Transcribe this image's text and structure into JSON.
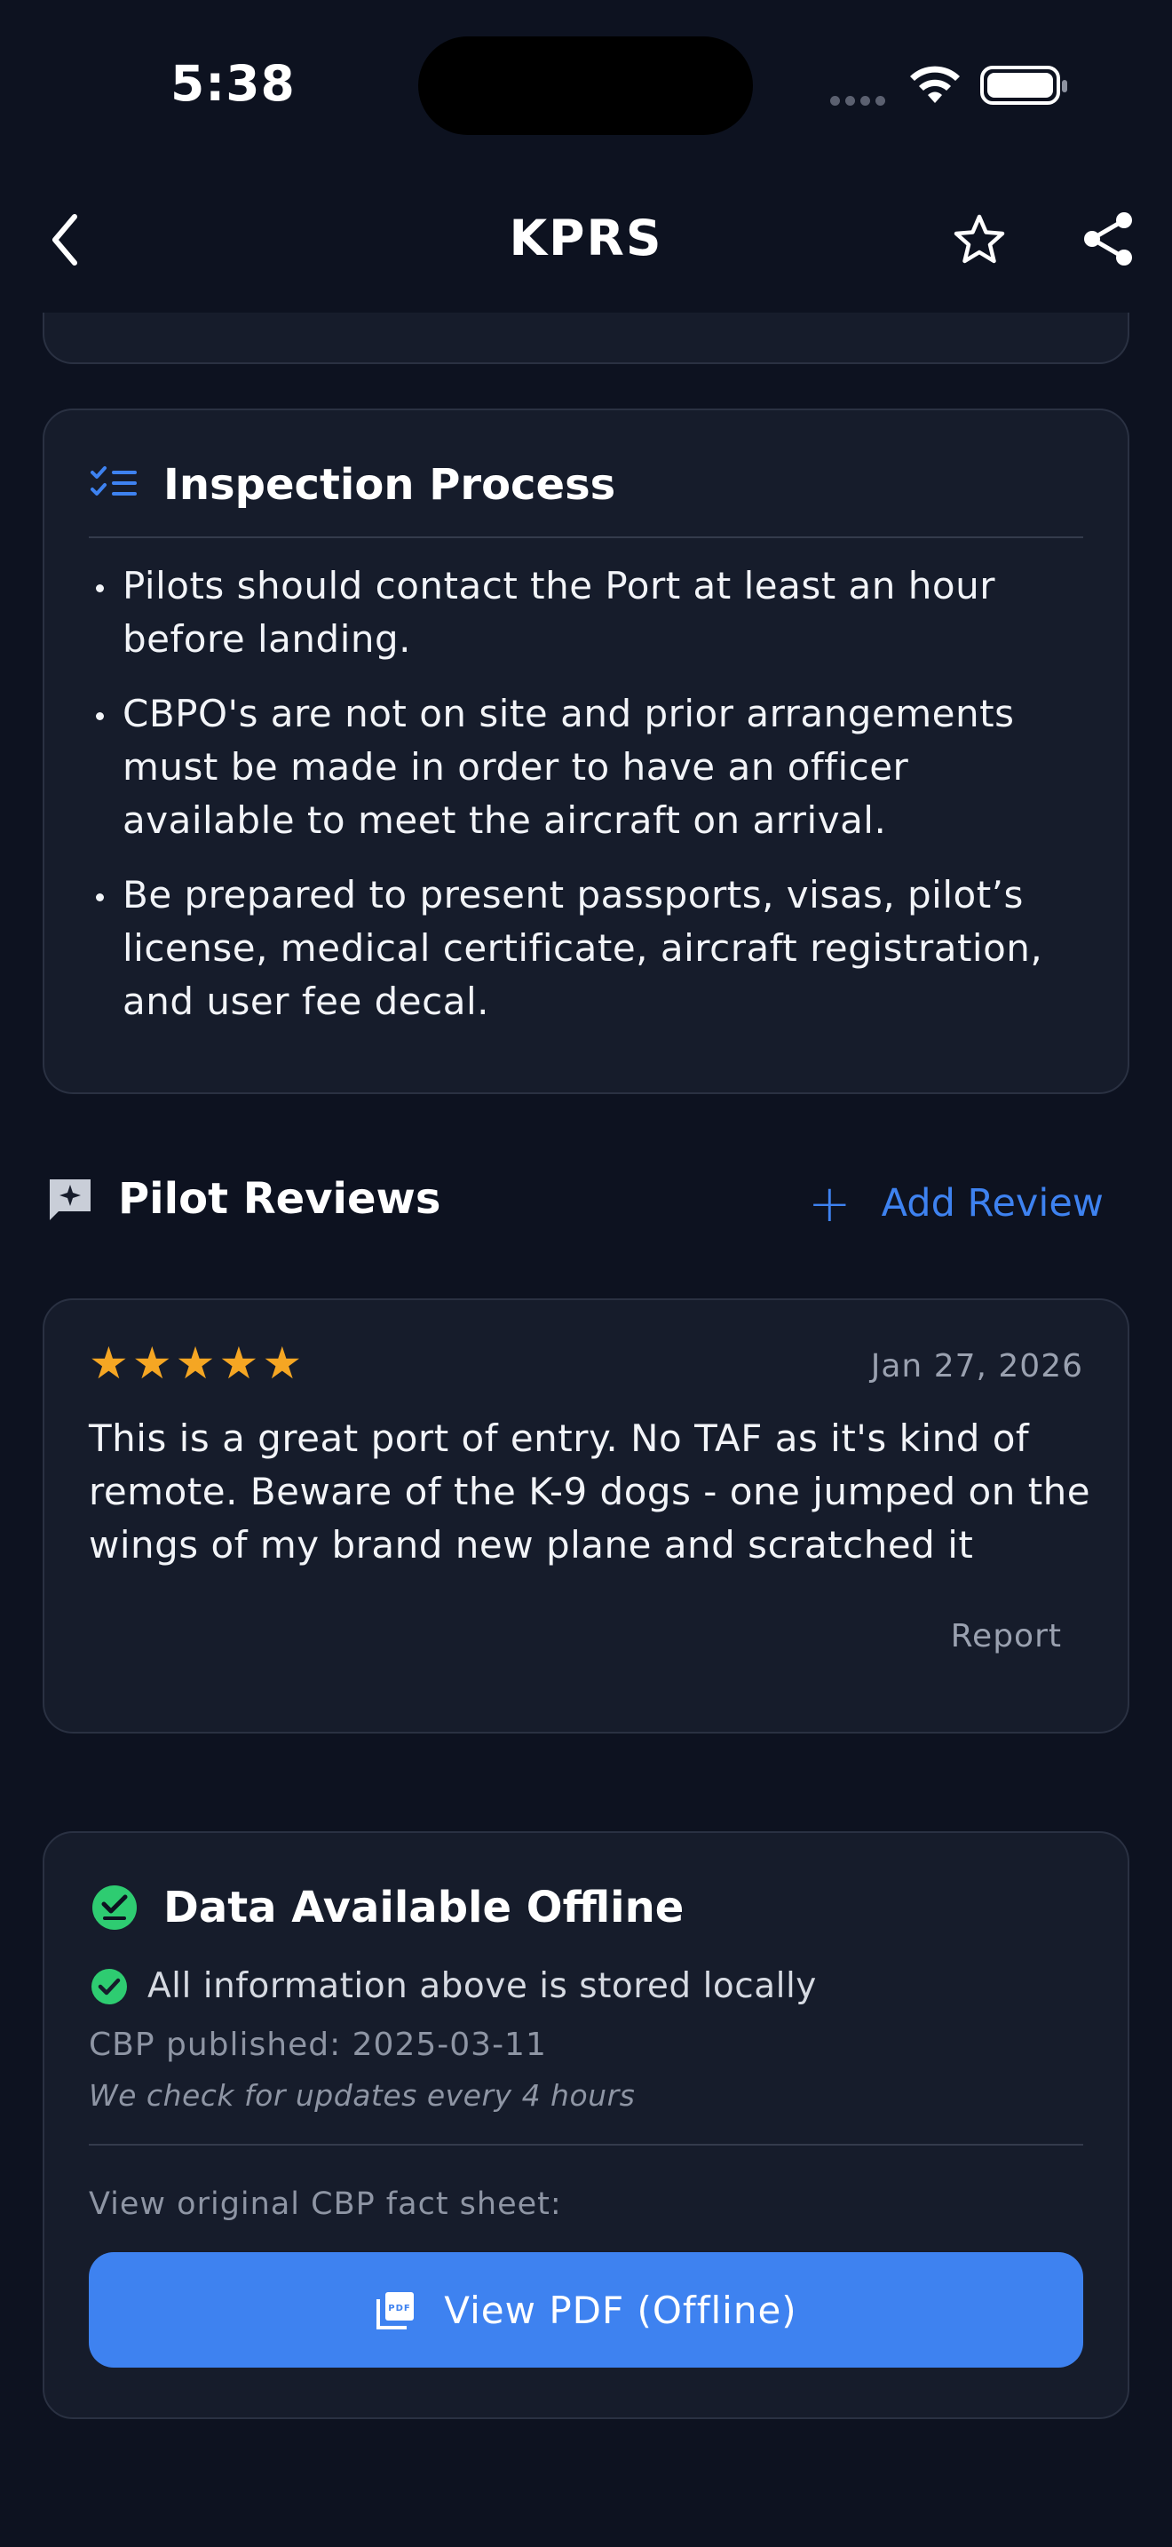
{
  "status_bar": {
    "time": "5:38"
  },
  "nav": {
    "title": "KPRS"
  },
  "inspection": {
    "title": "Inspection Process",
    "items": [
      "Pilots should contact the Port at least an hour before landing.",
      "CBPO's are not on site and prior arrangements must be made in order to have an officer available to meet the aircraft on arrival.",
      "Be prepared to present passports, visas, pilot’s license, medical certificate, aircraft registration, and user fee decal."
    ]
  },
  "reviews": {
    "title": "Pilot Reviews",
    "add_label": "Add Review",
    "items": [
      {
        "rating": 5,
        "date": "Jan 27, 2026",
        "text": "This is a great port of entry. No TAF as it's kind of remote. Beware of the K-9 dogs - one jumped on the wings of my brand new plane and scratched it",
        "report_label": "Report"
      }
    ]
  },
  "offline": {
    "title": "Data Available Offline",
    "stored_text": "All information above is stored locally",
    "published": "CBP published: 2025-03-11",
    "interval": "We check for updates every 4 hours",
    "view_original": "View original CBP fact sheet:",
    "pdf_button": "View PDF (Offline)"
  },
  "colors": {
    "accent": "#3e82f0",
    "star": "#f5a623",
    "success": "#2ecc71",
    "background": "#0d1220",
    "card": "#161c2b"
  }
}
